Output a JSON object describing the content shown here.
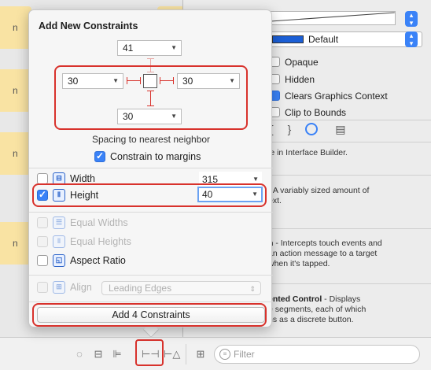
{
  "popover": {
    "title": "Add New Constraints",
    "top_value": "41",
    "left_value": "30",
    "right_value": "30",
    "bottom_value": "30",
    "spacing_label": "Spacing to nearest neighbor",
    "constrain_margins": {
      "label": "Constrain to margins",
      "checked": true
    },
    "width": {
      "label": "Width",
      "checked": false,
      "value": "315"
    },
    "height": {
      "label": "Height",
      "checked": true,
      "value": "40"
    },
    "equal_widths": {
      "label": "Equal Widths",
      "enabled": false
    },
    "equal_heights": {
      "label": "Equal Heights",
      "enabled": false
    },
    "aspect_ratio": {
      "label": "Aspect Ratio",
      "checked": false
    },
    "align": {
      "label": "Align",
      "value": "Leading Edges",
      "enabled": false
    },
    "add_button": "Add 4 Constraints"
  },
  "background": {
    "left_letters": [
      "n",
      "n",
      "n",
      "n"
    ],
    "right_letter": "n"
  },
  "inspector": {
    "background_select": "Default",
    "options": [
      {
        "label": "Opaque",
        "checked": false
      },
      {
        "label": "Hidden",
        "checked": false
      },
      {
        "label": "Clears Graphics Context",
        "checked": true
      },
      {
        "label": "Clip to Bounds",
        "checked": false
      }
    ],
    "library_tabs": [
      "{}",
      "⦿",
      "▤"
    ],
    "library_items": [
      {
        "title": "",
        "text": "le in Interface Builder."
      },
      {
        "title": "",
        "text": "- A variably sized amount of",
        "text2": "ext."
      },
      {
        "title": "n",
        "text": " - Intercepts touch events and",
        "text2": "an action message to a target",
        "text3": "when it's tapped."
      },
      {
        "title": "ented Control",
        "text": " - Displays",
        "text2": "e segments, each of which",
        "text3": "ns as a discrete button."
      }
    ]
  },
  "toolbar": {
    "filter_placeholder": "Filter"
  },
  "colors": {
    "highlight": "#d8322c",
    "accent": "#3a82f7"
  }
}
